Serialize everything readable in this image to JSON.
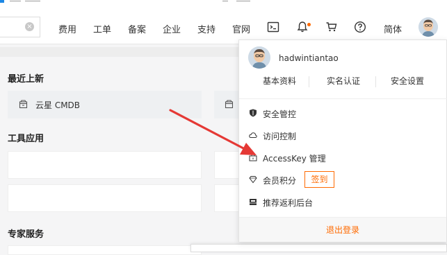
{
  "header": {
    "nav": [
      "费用",
      "工单",
      "备案",
      "企业",
      "支持",
      "官网"
    ],
    "lang": "简体",
    "icons": [
      "terminal-icon",
      "bell-icon",
      "cart-icon",
      "help-icon"
    ],
    "clear_icon": "×"
  },
  "sections": {
    "recent": "最近上新",
    "tools": "工具应用",
    "experts": "专家服务"
  },
  "recent_item": {
    "label": "云星 CMDB"
  },
  "dropdown": {
    "username": "hadwintiantao",
    "tabs": [
      "基本资料",
      "实名认证",
      "安全设置"
    ],
    "menu": [
      {
        "label": "安全管控",
        "icon": "shield-icon"
      },
      {
        "label": "访问控制",
        "icon": "cloud-icon"
      },
      {
        "label": "AccessKey 管理",
        "icon": "key-icon"
      },
      {
        "label": "会员积分",
        "icon": "diamond-icon"
      },
      {
        "label": "推荐返利后台",
        "icon": "gift-icon"
      }
    ],
    "signin": "签到",
    "logout": "退出登录"
  },
  "colors": {
    "accent": "#ff6a00",
    "arrow": "#e53935",
    "panel_bg": "#f5f5f6"
  }
}
